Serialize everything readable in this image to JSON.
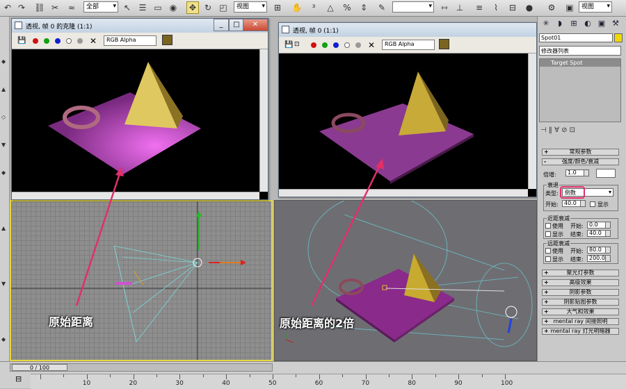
{
  "toolbar": {
    "select_filter": "全部",
    "refcoord": "视图",
    "named_sel": "视图"
  },
  "left_render": {
    "title": "透视, 帧 0 的克隆 (1:1)",
    "channel": "RGB Alpha",
    "colors": {
      "plane": "#c452c8",
      "pyramid": "#d8c050",
      "ring": "#b06a80"
    }
  },
  "right_render": {
    "title": "透视, 帧 0 (1:1)",
    "channel": "RGB Alpha",
    "colors": {
      "plane": "#8a3a90",
      "pyramid": "#c0a838",
      "ring": "#8a4a60"
    }
  },
  "annotations": {
    "left": "原始距离",
    "right": "原始距离的2倍"
  },
  "timeline": {
    "frame": "0 / 100",
    "ticks": [
      "10",
      "20",
      "30",
      "40",
      "50",
      "60",
      "70",
      "80",
      "90",
      "100"
    ]
  },
  "panel": {
    "object_name": "Spot01",
    "modifier_list": "修改器列表",
    "stack_item": "Target Spot",
    "rollout_general": "常规参数",
    "rollout_intensity": "强度/颜色/衰减",
    "multiplier_label": "倍增:",
    "multiplier_value": "1.0",
    "decay_group": "衰退",
    "type_label": "类型:",
    "type_value": "倒数",
    "start_label": "开始:",
    "start_value": "40.0",
    "show_label": "显示",
    "near_group": "近距衰减",
    "use_label": "使用",
    "start2_label": "开始:",
    "near_start": "0.0",
    "show2_label": "显示",
    "end_label": "结束:",
    "near_end": "40.0",
    "far_group": "远距衰减",
    "far_use": "使用",
    "far_start_label": "开始:",
    "far_start": "80.0",
    "far_show": "显示",
    "far_end_label": "结束:",
    "far_end": "200.0",
    "rollouts": [
      "聚光灯参数",
      "高级效果",
      "阴影参数",
      "阴影贴图参数",
      "大气和效果",
      "mental ray 间接照明",
      "mental ray 灯光明暗器"
    ]
  }
}
